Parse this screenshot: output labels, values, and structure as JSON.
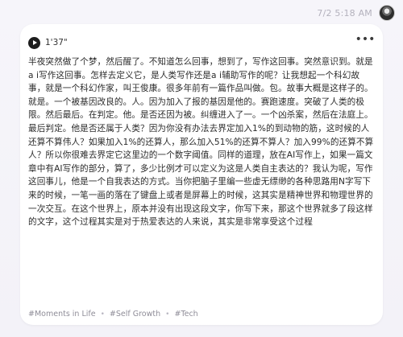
{
  "header": {
    "timestamp": "7/2 5:18 AM"
  },
  "note": {
    "audio_duration": "1'37\"",
    "more_label": "•••",
    "text": "半夜突然做了个梦，然后醒了。不知道怎么回事，想到了，写作这回事。突然意识到。就是a i写作这回事。怎样去定义它，是人类写作还是a i辅助写作的呢？让我想起一个科幻故事，就是一个科幻作家，叫王俊康。很多年前有一篇作品叫做。包。故事大概是这样子的。就是。一个被基因改良的。人。因为加入了报的基因是他的。赛跑速度。突破了人类的极限。然后最后。在判定。他。是否还因为被。纠缠进入了一。一个凶杀案，然后在法庭上。最后判定。他是否还属于人类？因为你没有办法去界定加入1%的到动物的筋，这时候的人还算不算伟人？如果加入1%的还算人，那么加入51%的还算不算人？加入99%的还算不算人？所以你很难去界定它这里边的一个数字阈值。同样的道理，放在AI写作上，如果一篇文章中有AI写作的部分，算了，多少比例才可以定义为这是人类自主表达的？我认为呢，写作这回事儿，他是一个自我表达的方式。当你把脑子里编一些虚无缥缈的各种思路用N字写下来的时候，一笔一画的落在了键盘上或者是屏幕上的时候，这其实是精神世界和物理世界的一次交互。在这个世界上，原本并没有出现这段文字，你写下来，那这个世界就多了段这样的文字，这个过程其实是对于热爱表达的人来说，其实是非常享受这个过程",
    "tags": [
      "#Moments in Life",
      "#Self Growth",
      "#Tech"
    ]
  },
  "colors": {
    "background": "#f6f5fa",
    "card": "#ffffff",
    "text": "#2b2b2b",
    "muted": "#8f8d98"
  },
  "icons": {
    "play": "play-icon",
    "more": "more-icon",
    "avatar": "avatar"
  }
}
